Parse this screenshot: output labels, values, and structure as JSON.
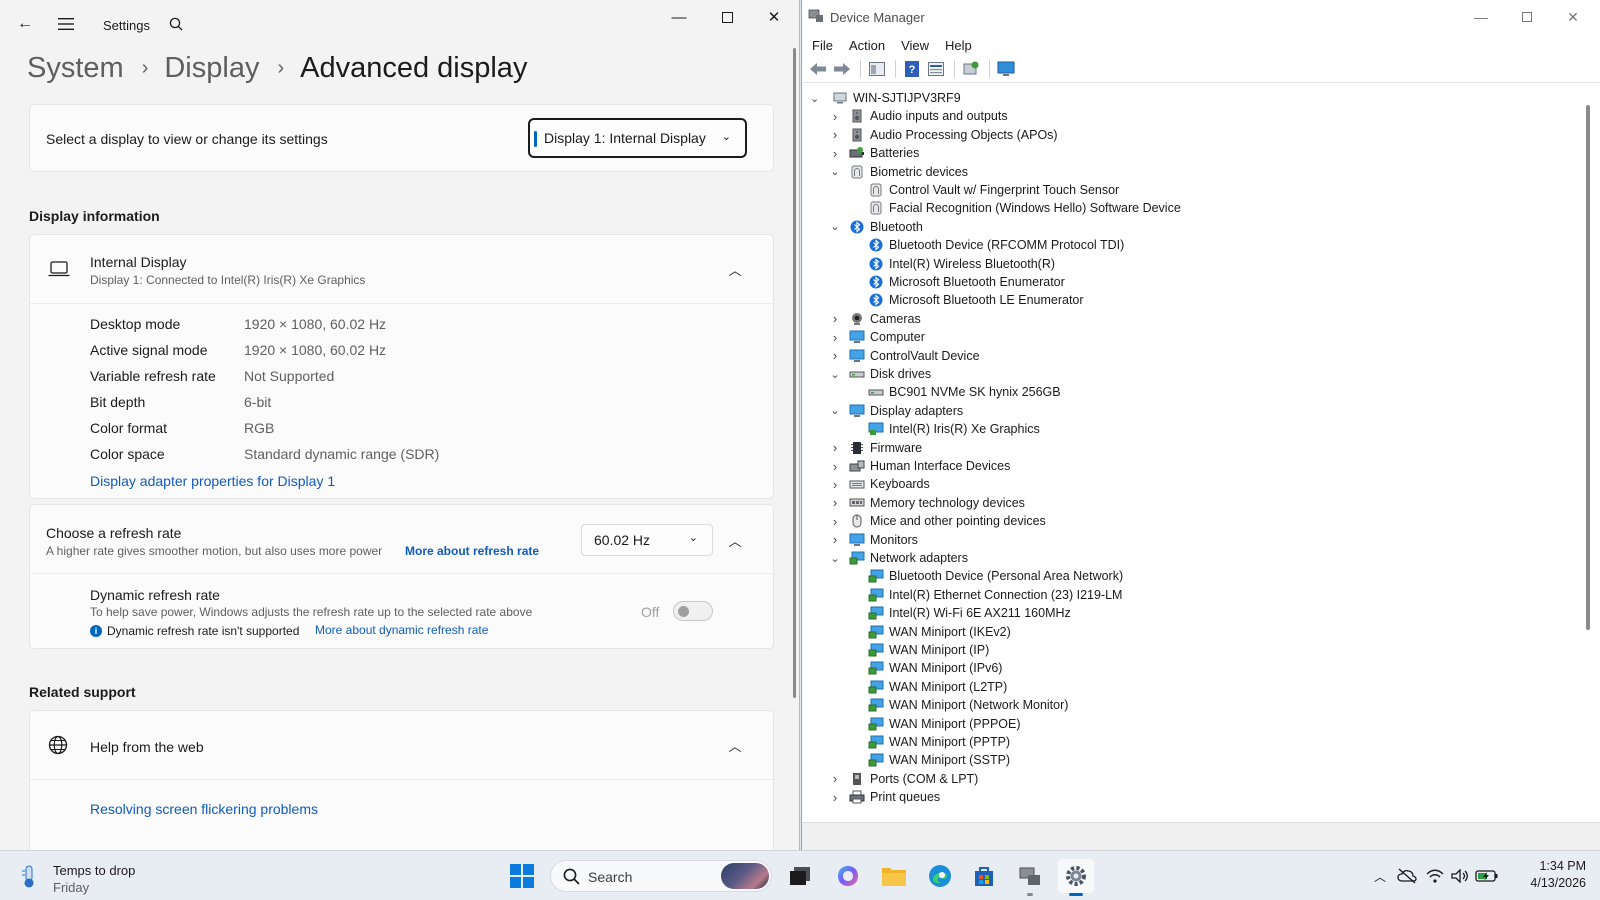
{
  "settings": {
    "app_title": "Settings",
    "breadcrumb": [
      "System",
      "Display",
      "Advanced display"
    ],
    "select_display": {
      "label": "Select a display to view or change its settings",
      "value": "Display 1: Internal Display"
    },
    "display_info": {
      "heading": "Display information",
      "name": "Internal Display",
      "subtitle": "Display 1: Connected to Intel(R) Iris(R) Xe Graphics",
      "rows": [
        {
          "key": "Desktop mode",
          "value": "1920 × 1080, 60.02 Hz"
        },
        {
          "key": "Active signal mode",
          "value": "1920 × 1080, 60.02 Hz"
        },
        {
          "key": "Variable refresh rate",
          "value": "Not Supported"
        },
        {
          "key": "Bit depth",
          "value": "6-bit"
        },
        {
          "key": "Color format",
          "value": "RGB"
        },
        {
          "key": "Color space",
          "value": "Standard dynamic range (SDR)"
        }
      ],
      "adapter_link": "Display adapter properties for Display 1"
    },
    "refresh": {
      "title": "Choose a refresh rate",
      "desc": "A higher rate gives smoother motion, but also uses more power",
      "link": "More about refresh rate",
      "value": "60.02 Hz",
      "dynamic_title": "Dynamic refresh rate",
      "dynamic_desc": "To help save power, Windows adjusts the refresh rate up to the selected rate above",
      "dynamic_note": "Dynamic refresh rate isn't supported",
      "dynamic_link": "More about dynamic refresh rate",
      "toggle_label": "Off"
    },
    "related": {
      "heading": "Related support",
      "help_title": "Help from the web",
      "link": "Resolving screen flickering problems"
    }
  },
  "device_manager": {
    "title": "Device Manager",
    "menu": [
      "File",
      "Action",
      "View",
      "Help"
    ],
    "root": "WIN-SJTIJPV3RF9",
    "tree": [
      {
        "label": "Audio inputs and outputs",
        "level": 1,
        "state": "collapsed",
        "icon": "speaker-icon"
      },
      {
        "label": "Audio Processing Objects (APOs)",
        "level": 1,
        "state": "collapsed",
        "icon": "speaker-icon"
      },
      {
        "label": "Batteries",
        "level": 1,
        "state": "collapsed",
        "icon": "battery-icon"
      },
      {
        "label": "Biometric devices",
        "level": 1,
        "state": "expanded",
        "icon": "biometric-icon"
      },
      {
        "label": "Control Vault w/ Fingerprint Touch Sensor",
        "level": 2,
        "state": "leaf",
        "icon": "biometric-icon"
      },
      {
        "label": "Facial Recognition (Windows Hello) Software Device",
        "level": 2,
        "state": "leaf",
        "icon": "biometric-icon"
      },
      {
        "label": "Bluetooth",
        "level": 1,
        "state": "expanded",
        "icon": "bluetooth-icon"
      },
      {
        "label": "Bluetooth Device (RFCOMM Protocol TDI)",
        "level": 2,
        "state": "leaf",
        "icon": "bluetooth-icon"
      },
      {
        "label": "Intel(R) Wireless Bluetooth(R)",
        "level": 2,
        "state": "leaf",
        "icon": "bluetooth-icon"
      },
      {
        "label": "Microsoft Bluetooth Enumerator",
        "level": 2,
        "state": "leaf",
        "icon": "bluetooth-icon"
      },
      {
        "label": "Microsoft Bluetooth LE Enumerator",
        "level": 2,
        "state": "leaf",
        "icon": "bluetooth-icon"
      },
      {
        "label": "Cameras",
        "level": 1,
        "state": "collapsed",
        "icon": "camera-icon"
      },
      {
        "label": "Computer",
        "level": 1,
        "state": "collapsed",
        "icon": "monitor-icon"
      },
      {
        "label": "ControlVault Device",
        "level": 1,
        "state": "collapsed",
        "icon": "monitor-icon"
      },
      {
        "label": "Disk drives",
        "level": 1,
        "state": "expanded",
        "icon": "disk-icon"
      },
      {
        "label": "BC901 NVMe SK hynix 256GB",
        "level": 2,
        "state": "leaf",
        "icon": "disk-icon"
      },
      {
        "label": "Display adapters",
        "level": 1,
        "state": "expanded",
        "icon": "monitor-icon"
      },
      {
        "label": "Intel(R) Iris(R) Xe Graphics",
        "level": 2,
        "state": "leaf",
        "icon": "display-adapter-icon"
      },
      {
        "label": "Firmware",
        "level": 1,
        "state": "collapsed",
        "icon": "chip-icon"
      },
      {
        "label": "Human Interface Devices",
        "level": 1,
        "state": "collapsed",
        "icon": "hid-icon"
      },
      {
        "label": "Keyboards",
        "level": 1,
        "state": "collapsed",
        "icon": "keyboard-icon"
      },
      {
        "label": "Memory technology devices",
        "level": 1,
        "state": "collapsed",
        "icon": "memory-icon"
      },
      {
        "label": "Mice and other pointing devices",
        "level": 1,
        "state": "collapsed",
        "icon": "mouse-icon"
      },
      {
        "label": "Monitors",
        "level": 1,
        "state": "collapsed",
        "icon": "monitor-icon"
      },
      {
        "label": "Network adapters",
        "level": 1,
        "state": "expanded",
        "icon": "network-icon"
      },
      {
        "label": "Bluetooth Device (Personal Area Network)",
        "level": 2,
        "state": "leaf",
        "icon": "network-icon"
      },
      {
        "label": "Intel(R) Ethernet Connection (23) I219-LM",
        "level": 2,
        "state": "leaf",
        "icon": "network-icon"
      },
      {
        "label": "Intel(R) Wi-Fi 6E AX211 160MHz",
        "level": 2,
        "state": "leaf",
        "icon": "network-icon"
      },
      {
        "label": "WAN Miniport (IKEv2)",
        "level": 2,
        "state": "leaf",
        "icon": "network-icon"
      },
      {
        "label": "WAN Miniport (IP)",
        "level": 2,
        "state": "leaf",
        "icon": "network-icon"
      },
      {
        "label": "WAN Miniport (IPv6)",
        "level": 2,
        "state": "leaf",
        "icon": "network-icon"
      },
      {
        "label": "WAN Miniport (L2TP)",
        "level": 2,
        "state": "leaf",
        "icon": "network-icon"
      },
      {
        "label": "WAN Miniport (Network Monitor)",
        "level": 2,
        "state": "leaf",
        "icon": "network-icon"
      },
      {
        "label": "WAN Miniport (PPPOE)",
        "level": 2,
        "state": "leaf",
        "icon": "network-icon"
      },
      {
        "label": "WAN Miniport (PPTP)",
        "level": 2,
        "state": "leaf",
        "icon": "network-icon"
      },
      {
        "label": "WAN Miniport (SSTP)",
        "level": 2,
        "state": "leaf",
        "icon": "network-icon"
      },
      {
        "label": "Ports (COM & LPT)",
        "level": 1,
        "state": "collapsed",
        "icon": "port-icon"
      },
      {
        "label": "Print queues",
        "level": 1,
        "state": "collapsed",
        "icon": "printer-icon"
      }
    ]
  },
  "taskbar": {
    "weather_title": "Temps to drop",
    "weather_sub": "Friday",
    "search_placeholder": "Search",
    "time": "1:34 PM",
    "date": "4/13/2026"
  },
  "colors": {
    "accent": "#0f5bbf",
    "win_blue": "#0067c0",
    "folder": "#f7c548",
    "bluetooth": "#1b6fd8"
  }
}
